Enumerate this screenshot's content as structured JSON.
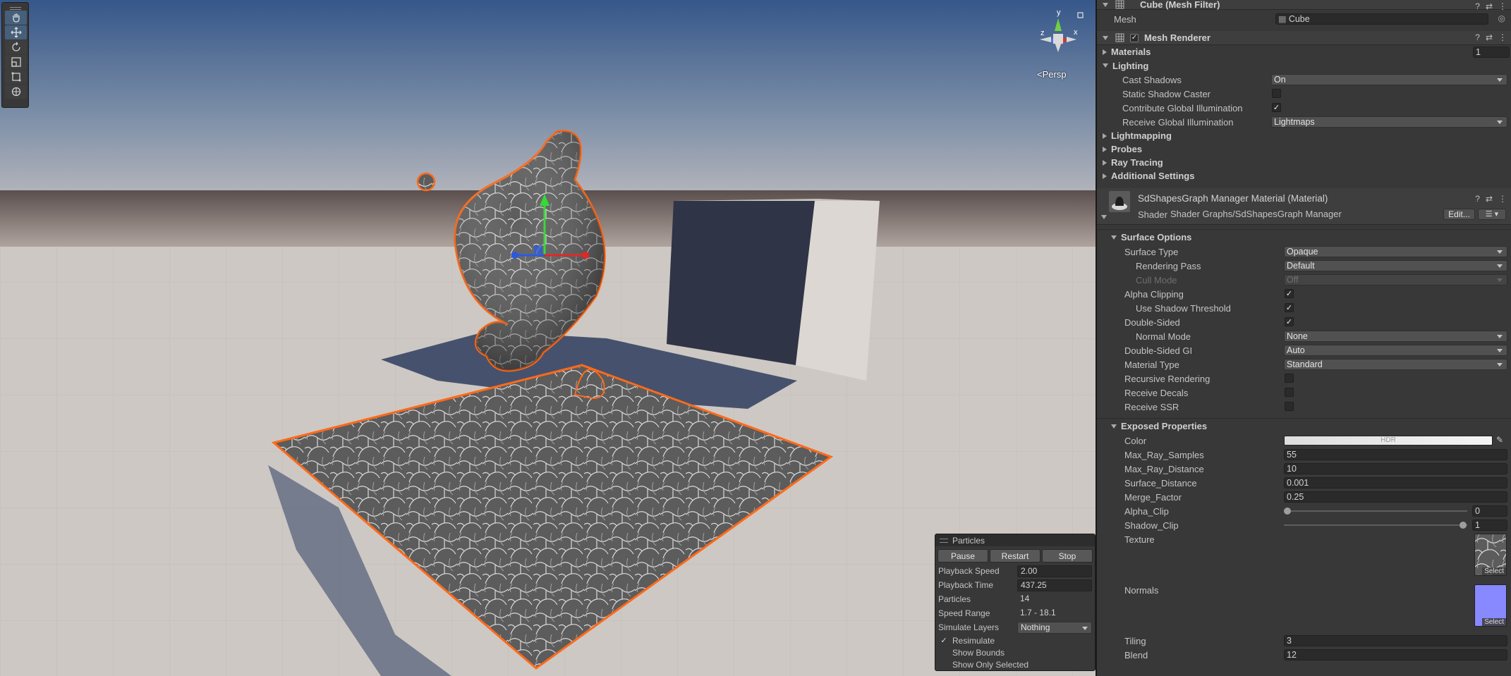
{
  "scene": {
    "persp_label": "<Persp",
    "gizmo_axes": {
      "x": "x",
      "y": "y",
      "z": "z"
    },
    "toolbar_tools": [
      "hand-tool",
      "move-tool",
      "rotate-tool",
      "scale-tool",
      "rect-tool",
      "transform-tool"
    ],
    "selection_color": "#ff6a1a"
  },
  "particles": {
    "title": "Particles",
    "buttons": {
      "pause": "Pause",
      "restart": "Restart",
      "stop": "Stop"
    },
    "playback_speed_label": "Playback Speed",
    "playback_speed": "2.00",
    "playback_time_label": "Playback Time",
    "playback_time": "437.25",
    "particles_label": "Particles",
    "particles_count": "14",
    "speed_range_label": "Speed Range",
    "speed_range": "1.7 - 18.1",
    "simulate_layers_label": "Simulate Layers",
    "simulate_layers": "Nothing",
    "resimulate": "Resimulate",
    "show_bounds": "Show Bounds",
    "show_only_selected": "Show Only Selected"
  },
  "inspector": {
    "mesh_filter": {
      "title": "Cube (Mesh Filter)",
      "mesh_label": "Mesh",
      "mesh_value": "Cube"
    },
    "mesh_renderer": {
      "title": "Mesh Renderer",
      "materials_label": "Materials",
      "materials_count": "1",
      "lighting_label": "Lighting",
      "cast_shadows_label": "Cast Shadows",
      "cast_shadows": "On",
      "static_shadow_caster_label": "Static Shadow Caster",
      "contribute_gi_label": "Contribute Global Illumination",
      "receive_gi_label": "Receive Global Illumination",
      "receive_gi": "Lightmaps",
      "lightmapping_label": "Lightmapping",
      "probes_label": "Probes",
      "ray_tracing_label": "Ray Tracing",
      "additional_settings_label": "Additional Settings"
    },
    "material": {
      "title": "SdShapesGraph Manager Material (Material)",
      "shader_label": "Shader",
      "shader_value": "Shader Graphs/SdShapesGraph Manager",
      "edit_button": "Edit..."
    },
    "surface_options": {
      "title": "Surface Options",
      "surface_type_label": "Surface Type",
      "surface_type": "Opaque",
      "rendering_pass_label": "Rendering Pass",
      "rendering_pass": "Default",
      "cull_mode_label": "Cull Mode",
      "cull_mode": "Off",
      "alpha_clipping_label": "Alpha Clipping",
      "use_shadow_threshold_label": "Use Shadow Threshold",
      "double_sided_label": "Double-Sided",
      "normal_mode_label": "Normal Mode",
      "normal_mode": "None",
      "double_sided_gi_label": "Double-Sided GI",
      "double_sided_gi": "Auto",
      "material_type_label": "Material Type",
      "material_type": "Standard",
      "recursive_rendering_label": "Recursive Rendering",
      "receive_decals_label": "Receive Decals",
      "receive_ssr_label": "Receive SSR"
    },
    "exposed_properties": {
      "title": "Exposed Properties",
      "color_label": "Color",
      "color_hdr": "HDR",
      "max_ray_samples_label": "Max_Ray_Samples",
      "max_ray_samples": "55",
      "max_ray_distance_label": "Max_Ray_Distance",
      "max_ray_distance": "10",
      "surface_distance_label": "Surface_Distance",
      "surface_distance": "0.001",
      "merge_factor_label": "Merge_Factor",
      "merge_factor": "0.25",
      "alpha_clip_label": "Alpha_Clip",
      "alpha_clip": "0",
      "shadow_clip_label": "Shadow_Clip",
      "shadow_clip": "1",
      "texture_label": "Texture",
      "texture_select": "Select",
      "normals_label": "Normals",
      "normals_select": "Select",
      "normals_color": "#8888ff",
      "tiling_label": "Tiling",
      "tiling": "3",
      "blend_label": "Blend",
      "blend": "12"
    }
  }
}
